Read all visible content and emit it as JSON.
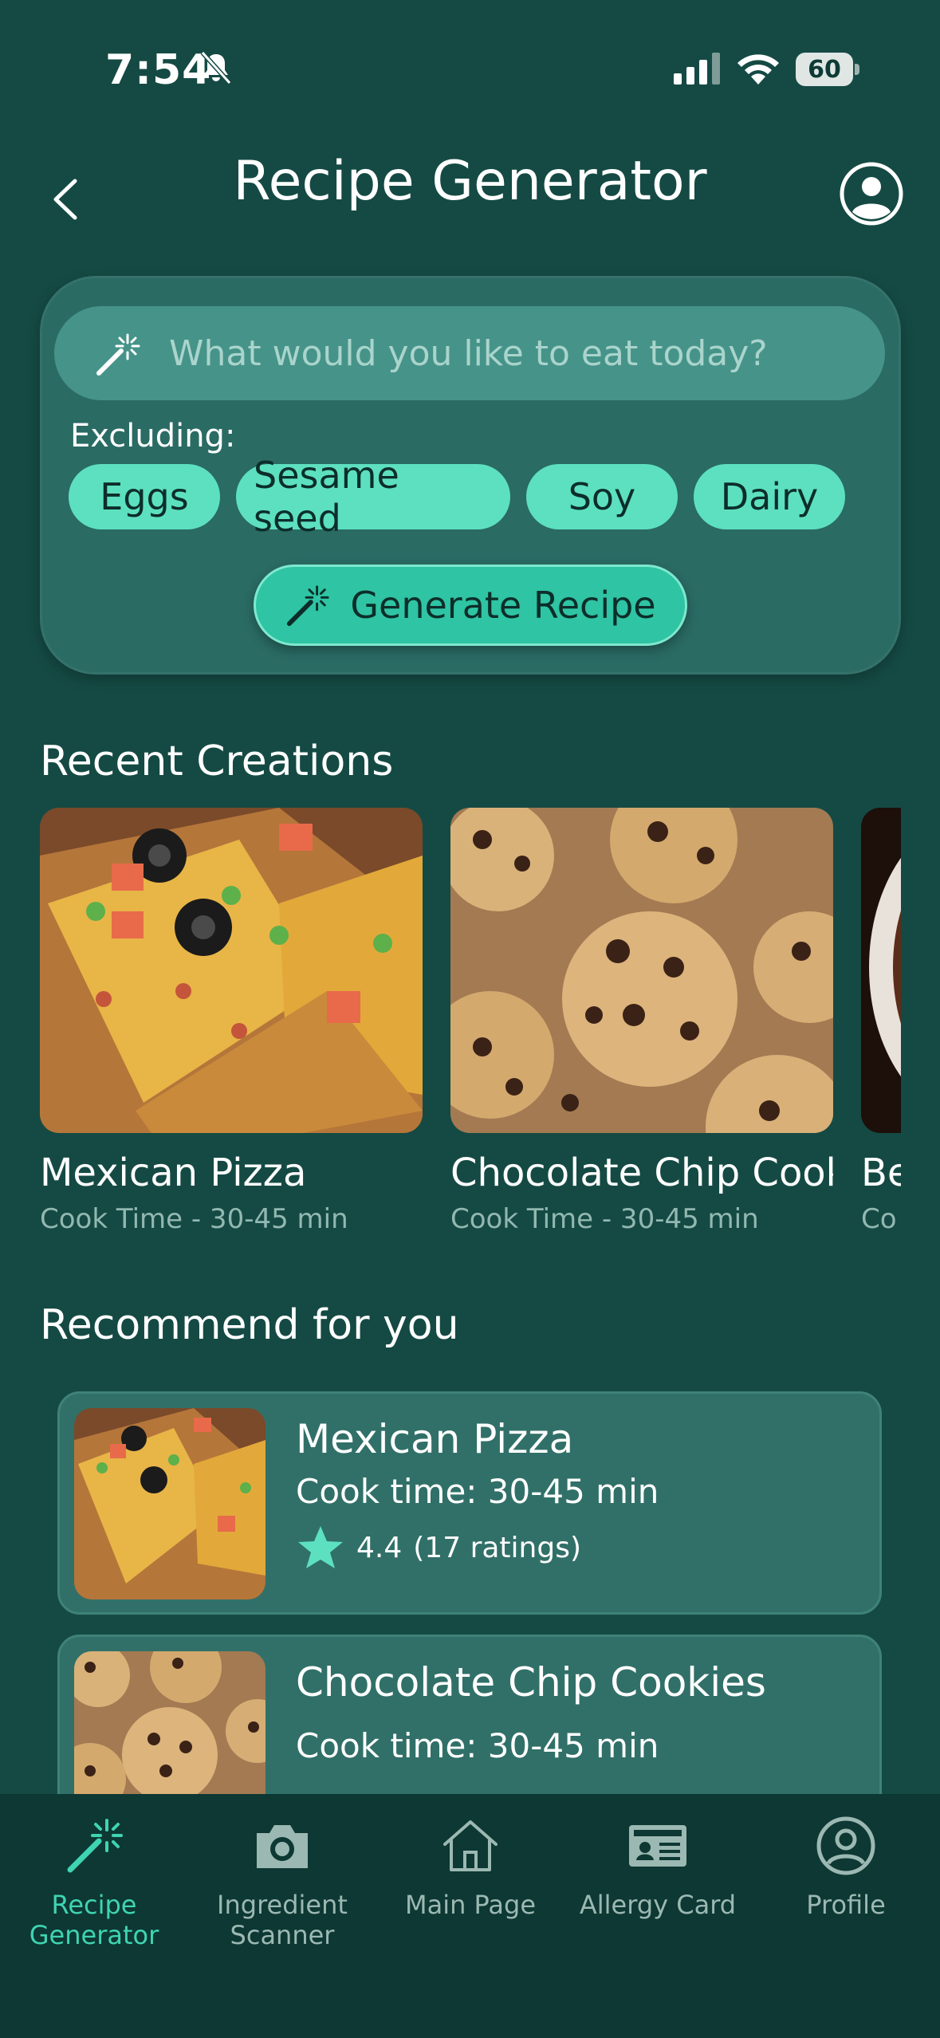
{
  "status_bar": {
    "time": "7:54",
    "battery": "60"
  },
  "header": {
    "title": "Recipe Generator"
  },
  "generator": {
    "search_placeholder": "What would you like to eat today?",
    "excluding_label": "Excluding:",
    "exclusions": [
      "Eggs",
      "Sesame seed",
      "Soy",
      "Dairy"
    ],
    "generate_label": "Generate Recipe"
  },
  "recent": {
    "title": "Recent Creations",
    "items": [
      {
        "name": "Mexican Pizza",
        "time": "Cook Time - 30-45 min"
      },
      {
        "name": "Chocolate Chip Cook",
        "time": "Cook Time - 30-45 min"
      },
      {
        "name": "Be",
        "time": "Co"
      }
    ]
  },
  "recommend": {
    "title": "Recommend for you",
    "items": [
      {
        "name": "Mexican Pizza",
        "time": "Cook time: 30-45 min",
        "rating": "4.4",
        "ratings_count": "(17 ratings)"
      },
      {
        "name": "Chocolate Chip Cookies",
        "time": "Cook time: 30-45 min"
      }
    ]
  },
  "tabs": [
    {
      "label": "Recipe\nGenerator",
      "icon": "magic-wand-icon",
      "active": true
    },
    {
      "label": "Ingredient\nScanner",
      "icon": "camera-icon",
      "active": false
    },
    {
      "label": "Main Page",
      "icon": "home-icon",
      "active": false
    },
    {
      "label": "Allergy Card",
      "icon": "id-card-icon",
      "active": false
    },
    {
      "label": "Profile",
      "icon": "user-circle-icon",
      "active": false
    }
  ],
  "colors": {
    "background": "#154a44",
    "accent": "#5de0c0",
    "tab_active": "#3fd4b2"
  }
}
